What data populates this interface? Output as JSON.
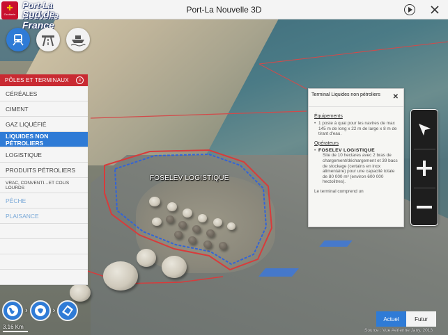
{
  "app": {
    "title": "Port-La Nouvelle 3D",
    "logo_line1": "Port-La Nouvelle",
    "logo_line2": "Sud de France",
    "logo_seal_text": "Occitanie"
  },
  "transport_modes": [
    {
      "name": "train",
      "active": true
    },
    {
      "name": "highway",
      "active": false
    },
    {
      "name": "boat",
      "active": false
    }
  ],
  "menu": {
    "header": "PÔLES ET TERMINAUX",
    "items": [
      {
        "label": "CÉRÉALES",
        "state": "normal"
      },
      {
        "label": "CIMENT",
        "state": "normal"
      },
      {
        "label": "GAZ LIQUÉFIÉ",
        "state": "normal"
      },
      {
        "label": "LIQUIDES NON PÉTROLIERS",
        "state": "selected"
      },
      {
        "label": "LOGISTIQUE",
        "state": "normal"
      },
      {
        "label": "PRODUITS PÉTROLIERS",
        "state": "normal"
      },
      {
        "label": "VRAC, CONVENTI…ET COLIS LOURDS",
        "state": "normal"
      },
      {
        "label": "PÊCHE",
        "state": "disabled"
      },
      {
        "label": "PLAISANCE",
        "state": "disabled"
      }
    ]
  },
  "info_panel": {
    "title": "Terminal Liquides non pétroliers",
    "equipment_heading": "Équipements",
    "equipment_text": "1 poste à quai pour les navires de max 145 m de long x 22 m de large x 8 m de tirant d'eau.",
    "operators_heading": "Opérateurs",
    "operator_name": "FOSELEV LOGISTIQUE",
    "operator_desc": "Site de 10 hectares avec 2 bras de chargement/déchargement et 39 bacs de stockage (certains en inox alimentaire) pour une capacité totale de 80 000 m³ (environ 600 000 hectolitres).",
    "more_text": "Le terminal comprend un"
  },
  "map": {
    "site_label": "FOSELEV LOGISTIQUE",
    "scale": "3.16 Km",
    "source": "Source : Vue Aérienne Jany, 2013"
  },
  "time_toggle": {
    "current": "Actuel",
    "future": "Futur"
  },
  "colors": {
    "accent_blue": "#2f7bd6",
    "header_red": "#c92a32"
  }
}
